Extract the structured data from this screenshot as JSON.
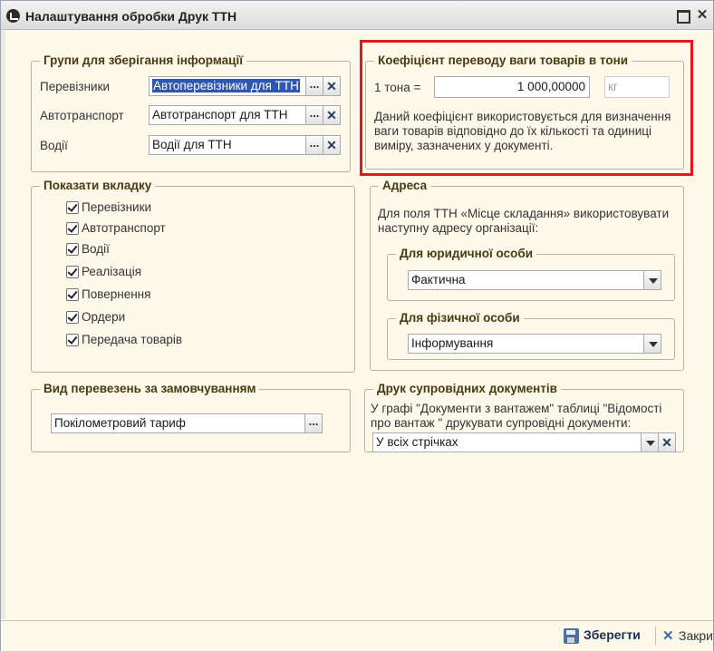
{
  "window": {
    "title": "Налаштування обробки Друк ТТН",
    "close_glyph": "✕"
  },
  "storage_groups": {
    "legend": "Групи для зберігання інформації",
    "rows": [
      {
        "label": "Перевізники",
        "value": "Автоперевізники для ТТН"
      },
      {
        "label": "Автотранспорт",
        "value": "Автотранспорт для ТТН"
      },
      {
        "label": "Водії",
        "value": "Водії для ТТН"
      }
    ],
    "dots": "...",
    "clear": "✕"
  },
  "weight": {
    "legend": "Коефіцієнт переводу ваги товарів в тони",
    "label": "1 тона =",
    "value": "1 000,00000",
    "unit": "кг",
    "description": "Даний коефіцієнт використовується для визначення ваги товарів відповідно до їх кількості та одиниці виміру, зазначених у документі."
  },
  "tabs": {
    "legend": "Показати вкладку",
    "items": [
      {
        "label": "Перевізники",
        "checked": true
      },
      {
        "label": "Автотранспорт",
        "checked": true
      },
      {
        "label": "Водії",
        "checked": true
      },
      {
        "label": "Реалізація",
        "checked": true
      },
      {
        "label": "Повернення",
        "checked": true
      },
      {
        "label": "Ордери",
        "checked": true
      },
      {
        "label": "Передача товарів",
        "checked": true
      }
    ]
  },
  "address": {
    "legend": "Адреса",
    "description": "Для поля ТТН «Місце складання» використовувати наступну адресу організації:",
    "legal": {
      "legend": "Для юридичної особи",
      "value": "Фактична"
    },
    "physical": {
      "legend": "Для фізичної особи",
      "value": "Інформування"
    }
  },
  "transport": {
    "legend": "Вид перевезень за замовчуванням",
    "value": "Покілометровий тариф",
    "dots": "..."
  },
  "docs": {
    "legend": "Друк супровідних документів",
    "description": "У графі \"Документи з вантажем\" таблиці \"Відомості про вантаж \" друкувати супровідні документи:",
    "value": "У всіх стрічках",
    "clear": "✕"
  },
  "footer": {
    "save_label": "Зберегти",
    "close_label": "Закрити",
    "close_glyph": "✕"
  }
}
